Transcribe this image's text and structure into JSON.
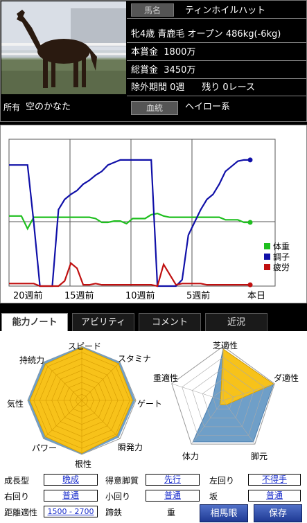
{
  "header": {
    "name_label": "馬名",
    "name": "ティンホイルハット",
    "profile": "牝4歳 青鹿毛 オープン 486kg(-6kg)",
    "prize_label": "本賞金",
    "prize_value": "1800万",
    "total_prize_label": "総賞金",
    "total_prize_value": "3450万",
    "exclusion_label": "除外期間",
    "exclusion_weeks": "0週",
    "remaining_races": "残り 0レース",
    "owner_label": "所有",
    "owner": "空のかなた",
    "lineage_button": "血統",
    "lineage_value": "ヘイロー系"
  },
  "chart_data": {
    "type": "line",
    "x": [
      "20週前",
      "15週前",
      "10週前",
      "5週前",
      "本日"
    ],
    "series": [
      {
        "name": "体重",
        "color": "#1fbf1f",
        "values": [
          55,
          55,
          55,
          45,
          54,
          54,
          54,
          54,
          54,
          54,
          54,
          54,
          54,
          54,
          53,
          50,
          50,
          51,
          51,
          49,
          53,
          53,
          53,
          56,
          57,
          55,
          54,
          54,
          54,
          54,
          54,
          54,
          54,
          54,
          54,
          52,
          52,
          52,
          50,
          50
        ]
      },
      {
        "name": "調子",
        "color": "#1010a8",
        "values": [
          95,
          95,
          95,
          95,
          50,
          0,
          0,
          0,
          60,
          68,
          72,
          75,
          80,
          83,
          87,
          90,
          95,
          97,
          99,
          99,
          99,
          99,
          99,
          99,
          0,
          0,
          0,
          0,
          5,
          40,
          50,
          60,
          68,
          72,
          80,
          90,
          94,
          98,
          99,
          99
        ]
      },
      {
        "name": "疲労",
        "color": "#c01010",
        "values": [
          2,
          2,
          2,
          2,
          2,
          0,
          0,
          0,
          0,
          4,
          18,
          14,
          1,
          1,
          2,
          1,
          1,
          1,
          1,
          1,
          1,
          1,
          1,
          1,
          0,
          17,
          9,
          1,
          2,
          2,
          2,
          2,
          1,
          1,
          1,
          1,
          1,
          1,
          1,
          1
        ]
      }
    ],
    "ylim": [
      0,
      100
    ],
    "legend": "right"
  },
  "tabs": [
    "能力ノート",
    "アビリティ",
    "コメント",
    "近況"
  ],
  "radar_left": {
    "labels": [
      "スピード",
      "スタミナ",
      "ゲート",
      "瞬発力",
      "根性",
      "パワー",
      "気性",
      "持続力"
    ],
    "values": [
      0.98,
      0.96,
      0.94,
      0.92,
      0.98,
      0.95,
      0.96,
      0.95
    ],
    "fill": "#f7c21a",
    "outline": "#6f9fc8"
  },
  "radar_right": {
    "labels": [
      "芝適性",
      "ダ適性",
      "脚元",
      "体力",
      "重適性"
    ],
    "values_orange": [
      0.95,
      0.98,
      0.1,
      0.1,
      0.05
    ],
    "values_blue": [
      0.95,
      0.98,
      0.95,
      0.95,
      0.2
    ],
    "orange": "#f7c21a",
    "blue": "#6f9fc8"
  },
  "stats": {
    "growth_label": "成長型",
    "growth": "晩成",
    "tactic_label": "得意脚質",
    "tactic": "先行",
    "left_turn_label": "左回り",
    "left_turn": "不得手",
    "right_turn_label": "右回り",
    "right_turn": "普通",
    "small_track_label": "小回り",
    "small_track": "普通",
    "slope_label": "坂",
    "slope": "普通",
    "distance_label": "距離適性",
    "distance": "1500 - 2700",
    "hoof_label": "蹄鉄",
    "hoof": "重"
  },
  "buttons": {
    "sobame": "相馬眼",
    "save": "保存"
  }
}
